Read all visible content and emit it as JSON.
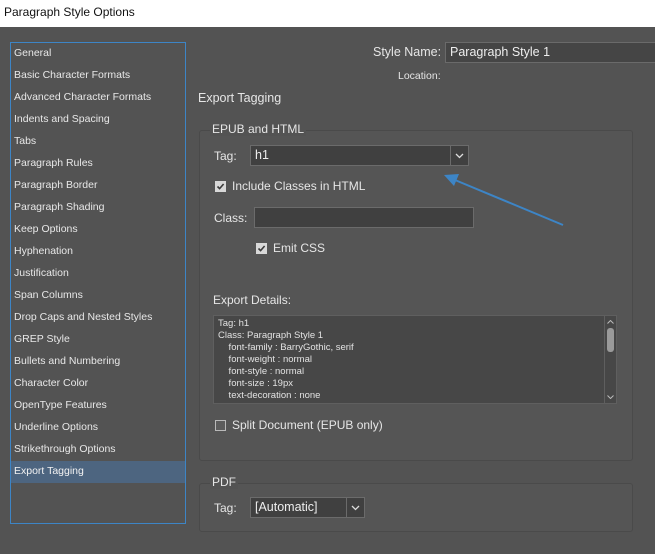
{
  "window": {
    "title": "Paragraph Style Options"
  },
  "sidebar": {
    "items": [
      {
        "label": "General"
      },
      {
        "label": "Basic Character Formats"
      },
      {
        "label": "Advanced Character Formats"
      },
      {
        "label": "Indents and Spacing"
      },
      {
        "label": "Tabs"
      },
      {
        "label": "Paragraph Rules"
      },
      {
        "label": "Paragraph Border"
      },
      {
        "label": "Paragraph Shading"
      },
      {
        "label": "Keep Options"
      },
      {
        "label": "Hyphenation"
      },
      {
        "label": "Justification"
      },
      {
        "label": "Span Columns"
      },
      {
        "label": "Drop Caps and Nested Styles"
      },
      {
        "label": "GREP Style"
      },
      {
        "label": "Bullets and Numbering"
      },
      {
        "label": "Character Color"
      },
      {
        "label": "OpenType Features"
      },
      {
        "label": "Underline Options"
      },
      {
        "label": "Strikethrough Options"
      },
      {
        "label": "Export Tagging"
      }
    ],
    "selected_index": 19
  },
  "header": {
    "style_name_label": "Style Name:",
    "style_name_value": "Paragraph Style 1",
    "location_label": "Location:"
  },
  "section": {
    "title": "Export Tagging"
  },
  "epub": {
    "group_title": "EPUB and HTML",
    "tag_label": "Tag:",
    "tag_value": "h1",
    "include_classes_label": "Include Classes in HTML",
    "include_classes_checked": true,
    "class_label": "Class:",
    "class_value": "",
    "emit_css_label": "Emit CSS",
    "emit_css_checked": true,
    "export_details_label": "Export Details:",
    "export_details_lines": [
      "Tag: h1",
      "Class: Paragraph Style 1",
      "    font-family : BarryGothic, serif",
      "    font-weight : normal",
      "    font-style : normal",
      "    font-size : 19px",
      "    text-decoration : none"
    ],
    "split_document_label": "Split Document (EPUB only)",
    "split_document_checked": false
  },
  "pdf": {
    "group_title": "PDF",
    "tag_label": "Tag:",
    "tag_value": "[Automatic]"
  },
  "colors": {
    "background": "#535353",
    "selection": "#4d6580",
    "sidebar_border": "#3d85c6",
    "annotation_arrow": "#3d85c6"
  }
}
